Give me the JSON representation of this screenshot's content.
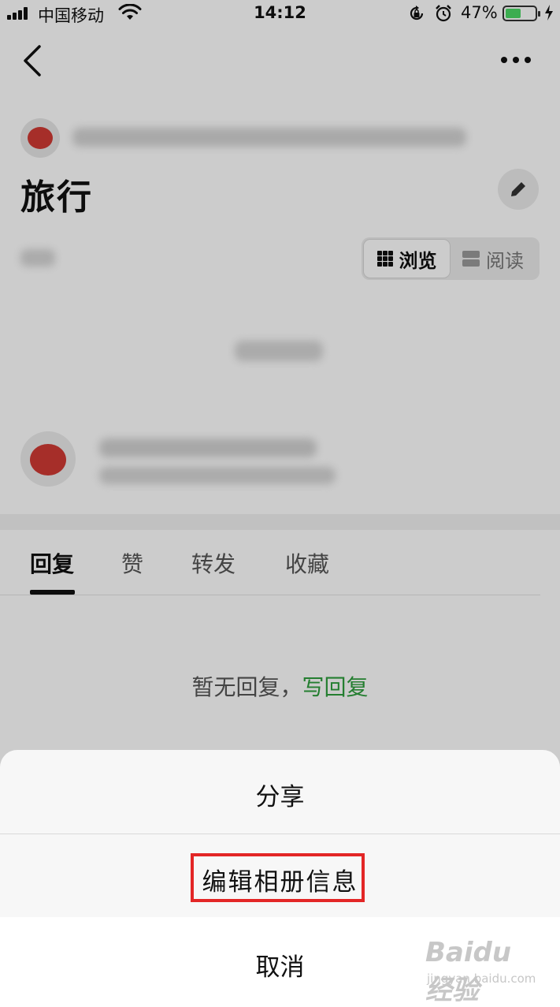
{
  "status_bar": {
    "carrier": "中国移动",
    "time": "14:12",
    "battery_percent": "47%",
    "battery_level": 0.47
  },
  "post": {
    "title": "旅行"
  },
  "view_toggle": {
    "browse_label": "浏览",
    "read_label": "阅读"
  },
  "tabs": [
    {
      "label": "回复",
      "active": true
    },
    {
      "label": "赞",
      "active": false
    },
    {
      "label": "转发",
      "active": false
    },
    {
      "label": "收藏",
      "active": false
    }
  ],
  "replies": {
    "empty_text": "暂无回复，",
    "write_link": "写回复"
  },
  "action_sheet": {
    "share": "分享",
    "edit_album_info": "编辑相册信息",
    "cancel": "取消"
  },
  "watermark": {
    "brand": "Baidu 经验",
    "url": "jingyan.baidu.com"
  },
  "colors": {
    "accent_green": "#2e9e3d",
    "highlight_red": "#e32626",
    "battery_green": "#4cd964"
  }
}
